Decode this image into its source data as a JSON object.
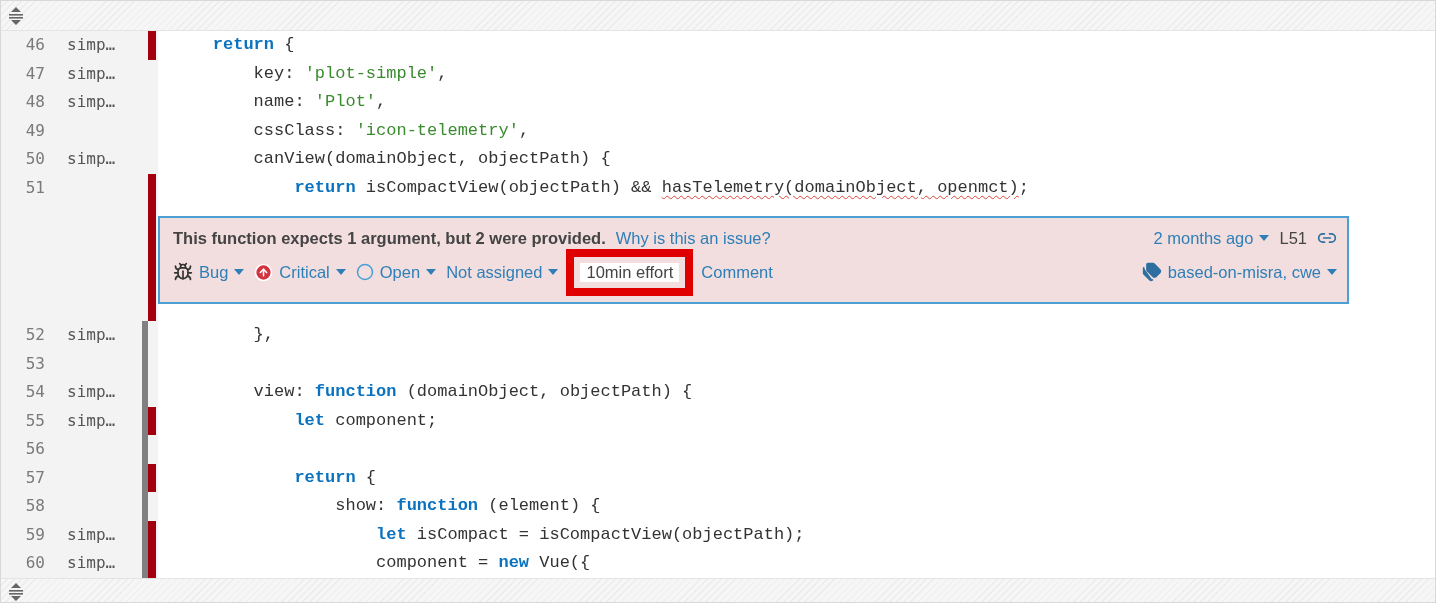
{
  "lines_before": [
    {
      "number": "46",
      "author": "simp…",
      "uncovered": true,
      "duplicated": false,
      "tokens": [
        {
          "kind": "keyword",
          "text": "    return"
        },
        {
          "kind": "plain",
          "text": " {"
        }
      ]
    },
    {
      "number": "47",
      "author": "simp…",
      "uncovered": false,
      "duplicated": false,
      "tokens": [
        {
          "kind": "plain",
          "text": "        key: "
        },
        {
          "kind": "string",
          "text": "'plot-simple'"
        },
        {
          "kind": "plain",
          "text": ","
        }
      ]
    },
    {
      "number": "48",
      "author": "simp…",
      "uncovered": false,
      "duplicated": false,
      "tokens": [
        {
          "kind": "plain",
          "text": "        name: "
        },
        {
          "kind": "string",
          "text": "'Plot'"
        },
        {
          "kind": "plain",
          "text": ","
        }
      ]
    },
    {
      "number": "49",
      "uncovered": false,
      "duplicated": false,
      "tokens": [
        {
          "kind": "plain",
          "text": "        cssClass: "
        },
        {
          "kind": "string",
          "text": "'icon-telemetry'"
        },
        {
          "kind": "plain",
          "text": ","
        }
      ]
    },
    {
      "number": "50",
      "author": "simp…",
      "uncovered": false,
      "duplicated": false,
      "tokens": [
        {
          "kind": "plain",
          "text": "        canView(domainObject, objectPath) {"
        }
      ]
    },
    {
      "number": "51",
      "uncovered": true,
      "duplicated": false,
      "tokens": [
        {
          "kind": "keyword",
          "text": "            return"
        },
        {
          "kind": "plain",
          "text": " isCompactView(objectPath) && "
        },
        {
          "kind": "error",
          "text": "hasTelemetry(domainObject, openmct)"
        },
        {
          "kind": "plain",
          "text": ";"
        }
      ]
    }
  ],
  "issue": {
    "message": "This function expects 1 argument, but 2 were provided.",
    "why_link": "Why is this an issue?",
    "date": "2 months ago",
    "line": "L51",
    "tags": "based-on-misra, cwe",
    "meta": [
      {
        "kind": "type",
        "label": "Bug",
        "dropdown": true,
        "highlighted": false
      },
      {
        "kind": "severity",
        "label": "Critical",
        "dropdown": true,
        "highlighted": false
      },
      {
        "kind": "status",
        "label": "Open",
        "dropdown": true,
        "highlighted": false
      },
      {
        "kind": "assignee",
        "label": "Not assigned",
        "dropdown": true,
        "highlighted": false
      },
      {
        "kind": "effort",
        "label": "10min effort",
        "dropdown": false,
        "highlighted": true
      },
      {
        "kind": "comment",
        "label": "Comment",
        "dropdown": false,
        "highlighted": false
      }
    ]
  },
  "lines_after": [
    {
      "number": "52",
      "author": "simp…",
      "uncovered": false,
      "duplicated": true,
      "tokens": [
        {
          "kind": "plain",
          "text": "        },"
        }
      ]
    },
    {
      "number": "53",
      "uncovered": false,
      "duplicated": true
    },
    {
      "number": "54",
      "author": "simp…",
      "uncovered": false,
      "duplicated": true,
      "tokens": [
        {
          "kind": "plain",
          "text": "        view: "
        },
        {
          "kind": "keyword",
          "text": "function"
        },
        {
          "kind": "plain",
          "text": " (domainObject, objectPath) {"
        }
      ]
    },
    {
      "number": "55",
      "author": "simp…",
      "uncovered": true,
      "duplicated": true,
      "tokens": [
        {
          "kind": "keyword",
          "text": "            let"
        },
        {
          "kind": "plain",
          "text": " component;"
        }
      ]
    },
    {
      "number": "56",
      "uncovered": false,
      "duplicated": true
    },
    {
      "number": "57",
      "uncovered": true,
      "duplicated": true,
      "tokens": [
        {
          "kind": "keyword",
          "text": "            return"
        },
        {
          "kind": "plain",
          "text": " {"
        }
      ]
    },
    {
      "number": "58",
      "uncovered": false,
      "duplicated": true,
      "tokens": [
        {
          "kind": "plain",
          "text": "                show: "
        },
        {
          "kind": "keyword",
          "text": "function"
        },
        {
          "kind": "plain",
          "text": " (element) {"
        }
      ]
    },
    {
      "number": "59",
      "author": "simp…",
      "uncovered": true,
      "duplicated": true,
      "tokens": [
        {
          "kind": "keyword",
          "text": "                    let"
        },
        {
          "kind": "plain",
          "text": " isCompact = isCompactView(objectPath);"
        }
      ]
    },
    {
      "number": "60",
      "author": "simp…",
      "uncovered": true,
      "duplicated": true,
      "tokens": [
        {
          "kind": "plain",
          "text": "                    component = "
        },
        {
          "kind": "keyword",
          "text": "new"
        },
        {
          "kind": "plain",
          "text": " Vue({"
        }
      ]
    }
  ]
}
